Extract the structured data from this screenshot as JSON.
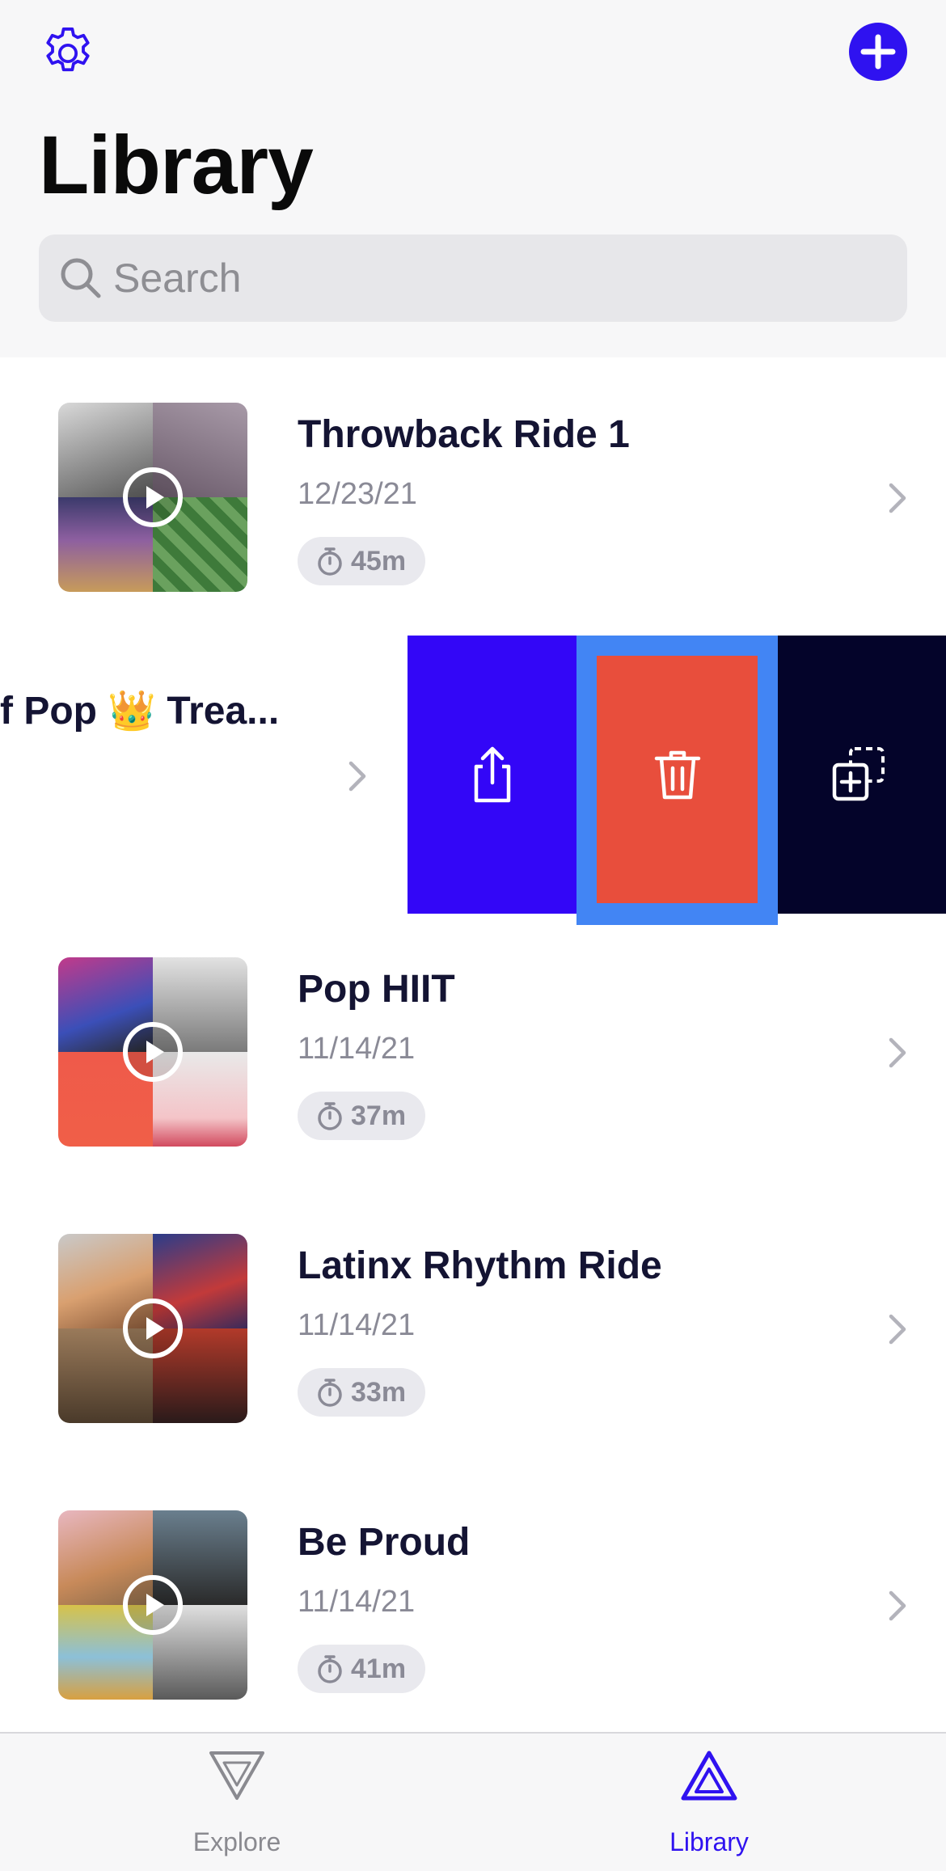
{
  "header": {
    "title": "Library",
    "settings_icon": "gear-icon",
    "add_icon": "plus-icon",
    "accent_color": "#2f12f0"
  },
  "search": {
    "placeholder": "Search",
    "value": ""
  },
  "rides": [
    {
      "title": "Throwback Ride 1",
      "date": "12/23/21",
      "duration": "45m"
    },
    {
      "title": "Pop HIIT",
      "date": "11/14/21",
      "duration": "37m"
    },
    {
      "title": "Latinx Rhythm Ride",
      "date": "11/14/21",
      "duration": "33m"
    },
    {
      "title": "Be Proud",
      "date": "11/14/21",
      "duration": "41m"
    }
  ],
  "swiped_row": {
    "title_visible": "f Pop 👑 Trea...",
    "actions": [
      {
        "name": "share",
        "icon": "share-icon",
        "color": "#3306f7"
      },
      {
        "name": "delete",
        "icon": "trash-icon",
        "color": "#e84e3c"
      },
      {
        "name": "duplicate",
        "icon": "duplicate-icon",
        "color": "#04042a"
      }
    ]
  },
  "tabbar": {
    "tabs": [
      {
        "label": "Explore",
        "icon": "explore-icon",
        "active": false
      },
      {
        "label": "Library",
        "icon": "library-icon",
        "active": true
      }
    ]
  }
}
